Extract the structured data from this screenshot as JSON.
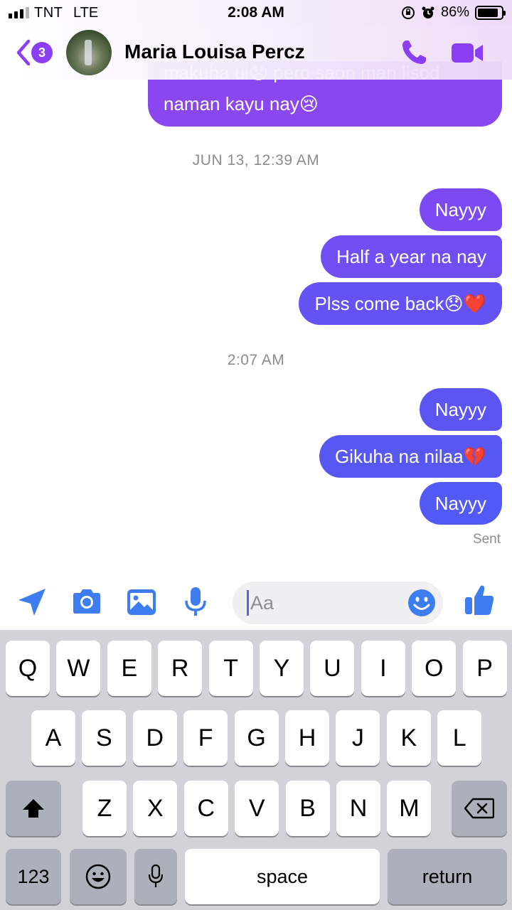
{
  "status_bar": {
    "carrier": "TNT",
    "network": "LTE",
    "time": "2:08 AM",
    "battery": "86%",
    "battery_level": 0.86
  },
  "header": {
    "unread_badge": "3",
    "contact_name": "Maria Louisa Percz",
    "icons": [
      "back-chevron-icon",
      "phone-icon",
      "video-camera-icon"
    ]
  },
  "conversation": {
    "partial_message": {
      "line1": "makuha ui😞 pero saon man lisod",
      "line2": "naman kayu nay😢"
    },
    "groups": [
      {
        "timestamp": "JUN 13, 12:39 AM",
        "messages": [
          "Nayyy",
          "Half a year na nay",
          "Plss come back😞❤️"
        ]
      },
      {
        "timestamp": "2:07 AM",
        "messages": [
          "Nayyy",
          "Gikuha na nilaa💔",
          "Nayyy"
        ]
      }
    ],
    "delivery_status": "Sent"
  },
  "colors": {
    "bubble_purple": "#8a47f0",
    "bubble_violet": "#6a4ff5",
    "bubble_blue": "#5558f4",
    "accent": "#8a3ff5",
    "composer_blue": "#3d7df0"
  },
  "composer": {
    "placeholder": "Aa",
    "icons": [
      "location-arrow-icon",
      "camera-icon",
      "photo-icon",
      "microphone-icon",
      "emoji-icon",
      "thumbs-up-icon"
    ]
  },
  "keyboard": {
    "row1": [
      "Q",
      "W",
      "E",
      "R",
      "T",
      "Y",
      "U",
      "I",
      "O",
      "P"
    ],
    "row2": [
      "A",
      "S",
      "D",
      "F",
      "G",
      "H",
      "J",
      "K",
      "L"
    ],
    "row3": [
      "Z",
      "X",
      "C",
      "V",
      "B",
      "N",
      "M"
    ],
    "numbers_key": "123",
    "space_key": "space",
    "return_key": "return"
  }
}
